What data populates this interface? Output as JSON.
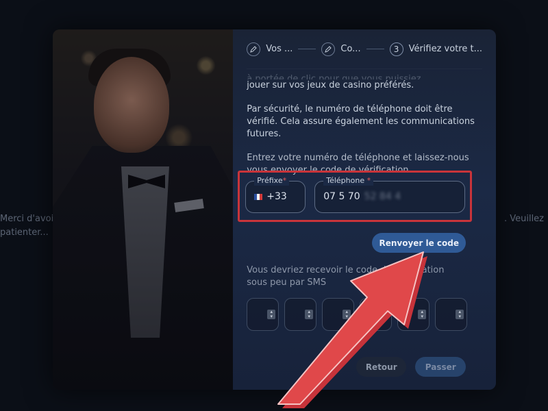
{
  "background": {
    "left_text": "Merci d'avoir patienter...",
    "right_text": ". Veuillez"
  },
  "stepper": {
    "steps": [
      {
        "label": "Vos ...",
        "icon": "pencil-icon"
      },
      {
        "label": "Co...",
        "icon": "pencil-icon"
      },
      {
        "number": "3",
        "label": "Vérifiez votre t..."
      }
    ]
  },
  "content": {
    "faded_line": "à portée de clic pour que vous puissiez",
    "p1": "jouer sur vos jeux de casino préférés.",
    "p2_a": "Par sécurité, le numéro de téléphone doit être vérifié. ",
    "p2_b": "Cela assure également les communications futures.",
    "p3": "Entrez votre numéro de téléphone et laissez-nous vous envoyer le code de vérification"
  },
  "phone": {
    "prefix_label": "Préfixe",
    "prefix_value": "+33",
    "phone_label": "Téléphone",
    "phone_value": "07 5 70",
    "phone_hidden": "52 84 4"
  },
  "resend_label": "Renvoyer le code",
  "sms_text": "Vous devriez recevoir le code de vérification sous peu par SMS",
  "code_boxes": [
    "",
    "",
    "",
    "",
    "",
    ""
  ],
  "footer": {
    "back_label": "Retour",
    "skip_label": "Passer"
  },
  "colors": {
    "panel": "#1b2945",
    "accent_button": "#2f5a96",
    "highlight_border": "#c9343a",
    "arrow": "#e0484a"
  }
}
